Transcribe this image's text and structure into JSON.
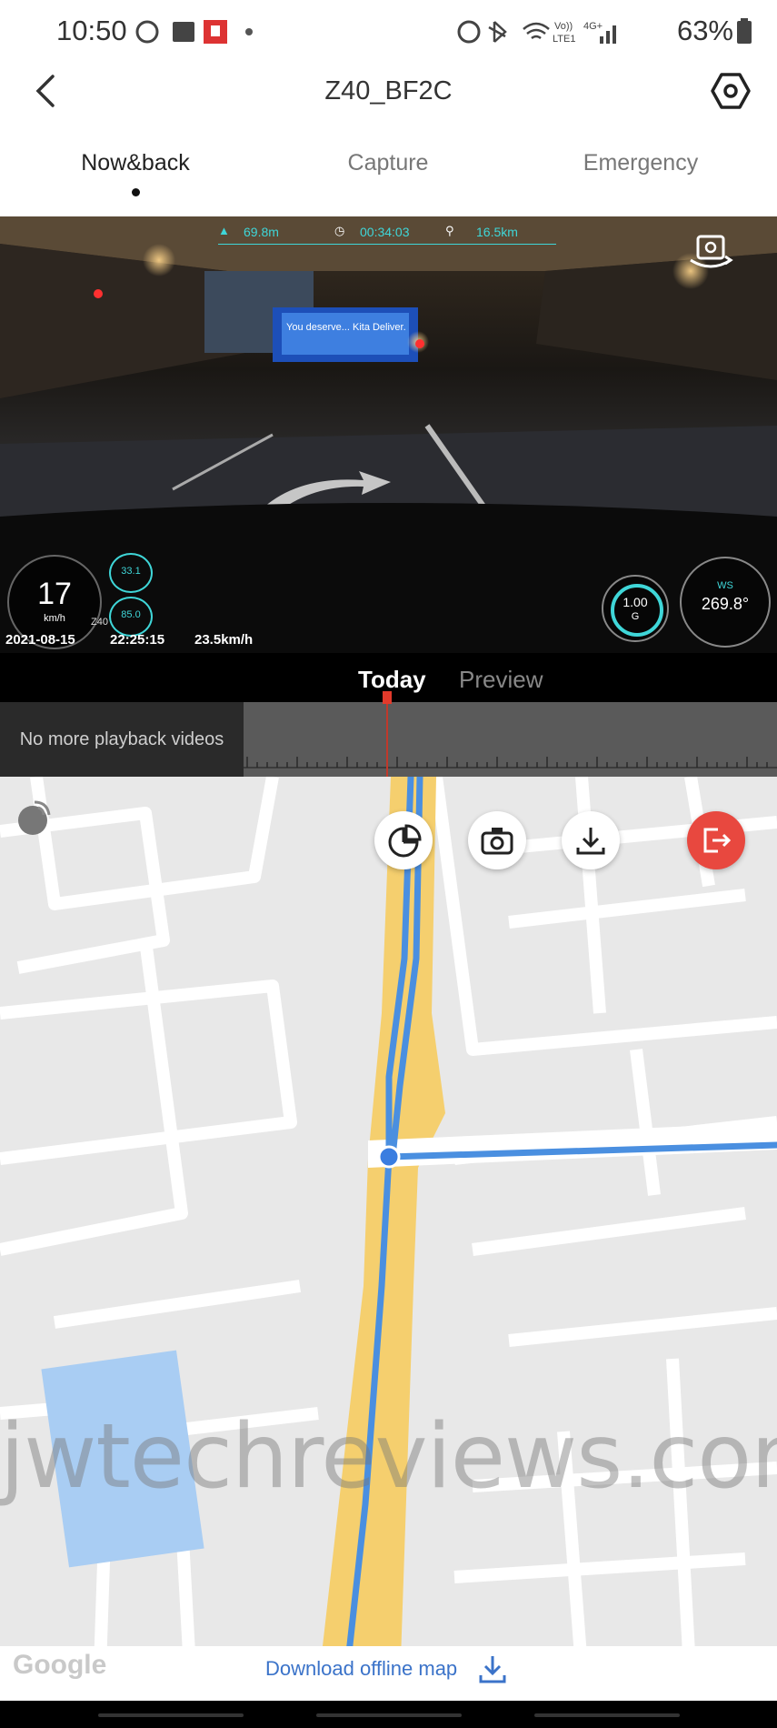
{
  "status_bar": {
    "time": "10:50",
    "battery": "63%",
    "network": "Vo) LTE1 4G+"
  },
  "header": {
    "title": "Z40_BF2C",
    "back_icon": "chevron-left-icon",
    "settings_icon": "hex-gear-icon"
  },
  "tabs": [
    {
      "label": "Now&back",
      "active": true
    },
    {
      "label": "Capture",
      "active": false
    },
    {
      "label": "Emergency",
      "active": false
    }
  ],
  "video_overlay": {
    "altitude": "69.8m",
    "elapsed": "00:34:03",
    "distance": "16.5km",
    "speed": "17",
    "speed_unit": "km/h",
    "gauge_a": "33.1",
    "gauge_b": "85.0",
    "datetime": "2021-08-15",
    "clock": "22:25:15",
    "gps_speed": "23.5km/h",
    "g_force": "1.00",
    "g_unit": "G",
    "heading": "269.8°",
    "compass_ws": "WS",
    "billboard": "You deserve... Kita Deliver.",
    "model_tag": "Z40"
  },
  "playback": {
    "tabs": [
      {
        "label": "Today",
        "active": true
      },
      {
        "label": "Preview",
        "active": false
      }
    ],
    "empty_message": "No more playback videos"
  },
  "map": {
    "offline_label": "Download offline map",
    "google_logo": "Google",
    "watermark": "jwtechreviews.com",
    "route_color": "#4a8fe0",
    "road_color": "#f5cf6e"
  },
  "colors": {
    "accent_blue": "#3b73c9",
    "exit_red": "#e8483f",
    "hud_cyan": "#3fd6d8"
  }
}
